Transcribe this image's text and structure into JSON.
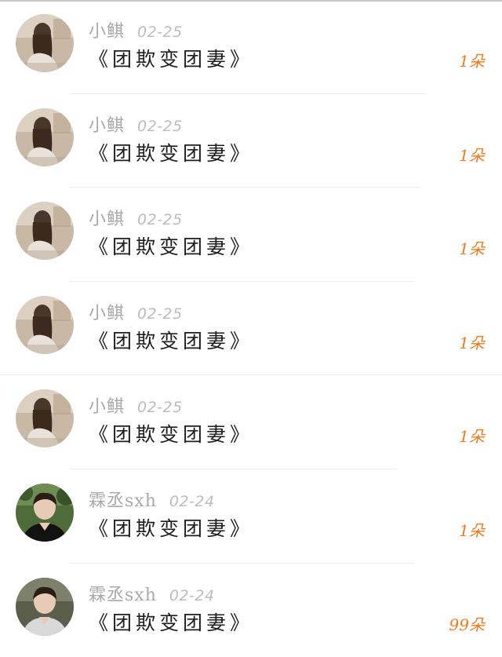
{
  "comments": [
    {
      "avatar": "girl-photo-avatar",
      "username": "小鲯",
      "date": "02-25",
      "message": "《团欺变团妻》",
      "gift": "1朵"
    },
    {
      "avatar": "girl-photo-avatar",
      "username": "小鲯",
      "date": "02-25",
      "message": "《团欺变团妻》",
      "gift": "1朵"
    },
    {
      "avatar": "girl-photo-avatar",
      "username": "小鲯",
      "date": "02-25",
      "message": "《团欺变团妻》",
      "gift": "1朵"
    },
    {
      "avatar": "girl-photo-avatar",
      "username": "小鲯",
      "date": "02-25",
      "message": "《团欺变团妻》",
      "gift": "1朵"
    },
    {
      "avatar": "girl-photo-avatar",
      "username": "小鲯",
      "date": "02-25",
      "message": "《团欺变团妻》",
      "gift": "1朵"
    },
    {
      "avatar": "boy-photo-avatar",
      "username": "霖丞sxh",
      "date": "02-24",
      "message": "《团欺变团妻》",
      "gift": "1朵"
    },
    {
      "avatar": "boy-photo-avatar",
      "username": "霖丞sxh",
      "date": "02-24",
      "message": "《团欺变团妻》",
      "gift": "99朵"
    }
  ],
  "colors": {
    "username": "#a9a9a9",
    "date": "#bdbdbd",
    "message": "#1e1e1e",
    "gift": "#f07a1e",
    "divider": "#ececec"
  }
}
